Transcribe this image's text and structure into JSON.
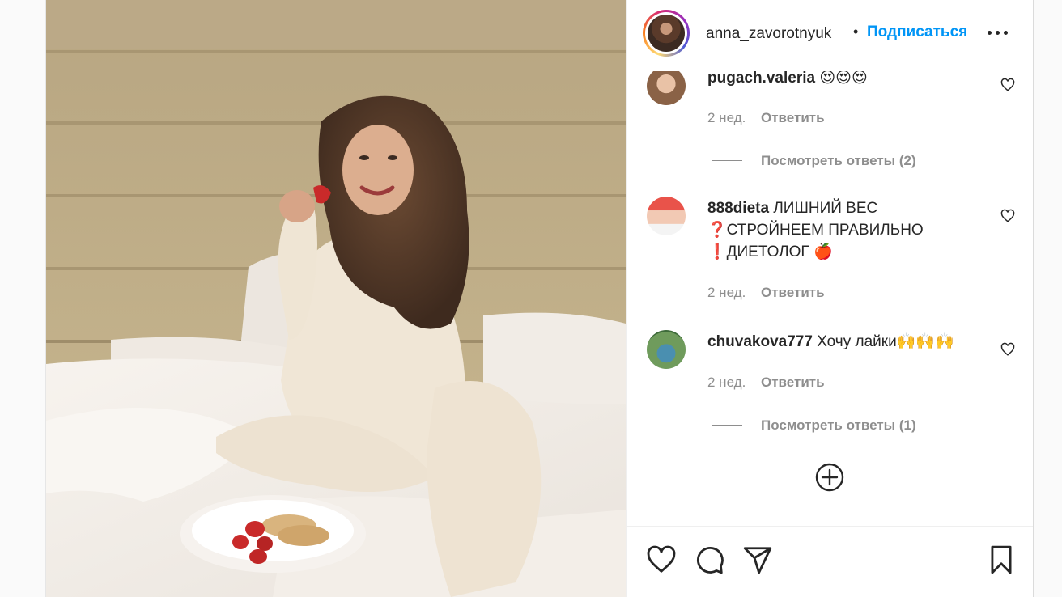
{
  "post": {
    "author": "anna_zavorotnyuk",
    "separator": "•",
    "follow_label": "Подписаться"
  },
  "comments": [
    {
      "user": "pugach.valeria",
      "text": "😍😍😍",
      "time": "2 нед.",
      "reply_label": "Ответить",
      "view_replies": "Посмотреть ответы (2)"
    },
    {
      "user": "888dieta",
      "text": "ЛИШНИЙ ВЕС ❓СТРОЙНЕЕМ ПРАВИЛЬНО ❗ДИЕТОЛОГ 🍎",
      "time": "2 нед.",
      "reply_label": "Ответить"
    },
    {
      "user": "chuvakova777",
      "text": "Хочу лайки🙌🙌🙌",
      "time": "2 нед.",
      "reply_label": "Ответить",
      "view_replies": "Посмотреть ответы (1)"
    }
  ],
  "icons": {
    "more": "more-options-icon",
    "comment_like": "heart-outline-icon",
    "load_more": "plus-circle-icon",
    "like": "heart-icon",
    "comment": "comment-bubble-icon",
    "share": "paper-plane-icon",
    "save": "bookmark-icon"
  },
  "colors": {
    "accent": "#0095f6",
    "text": "#262626",
    "secondary": "#8e8e8e"
  }
}
